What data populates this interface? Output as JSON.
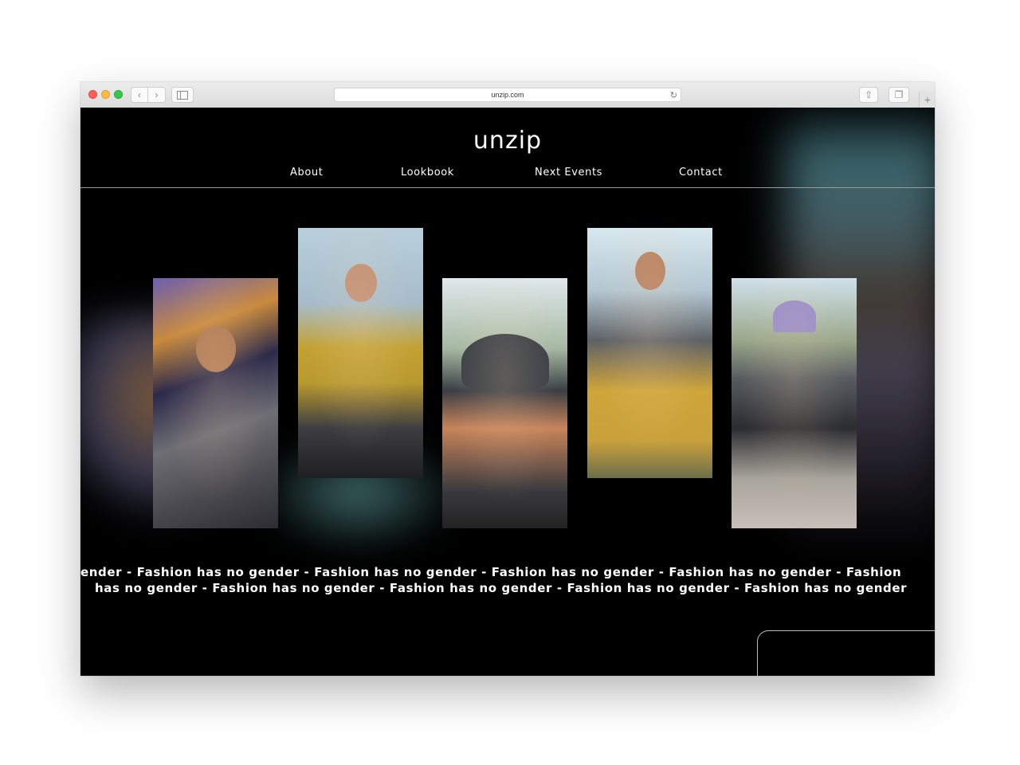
{
  "browser": {
    "url": "unzip.com"
  },
  "site": {
    "logo_text": "unzip",
    "nav": [
      {
        "label": "About"
      },
      {
        "label": "Lookbook"
      },
      {
        "label": "Next Events"
      },
      {
        "label": "Contact"
      }
    ],
    "ticker_line_1": "ender - Fashion has no gender - Fashion has no gender - Fashion has no gender - Fashion has no gender - Fashion",
    "ticker_line_2": "has no gender - Fashion has no gender - Fashion has no gender - Fashion has no gender - Fashion has no gender"
  },
  "icons": {
    "back": "chevron-left-icon",
    "forward": "chevron-right-icon",
    "sidebar": "sidebar-icon",
    "reload": "reload-icon",
    "share": "share-icon",
    "tabs": "tabs-icon",
    "new_tab": "plus-icon"
  },
  "colors": {
    "page_background": "#000000",
    "text": "#ffffff",
    "divider": "#9a9a9a"
  }
}
